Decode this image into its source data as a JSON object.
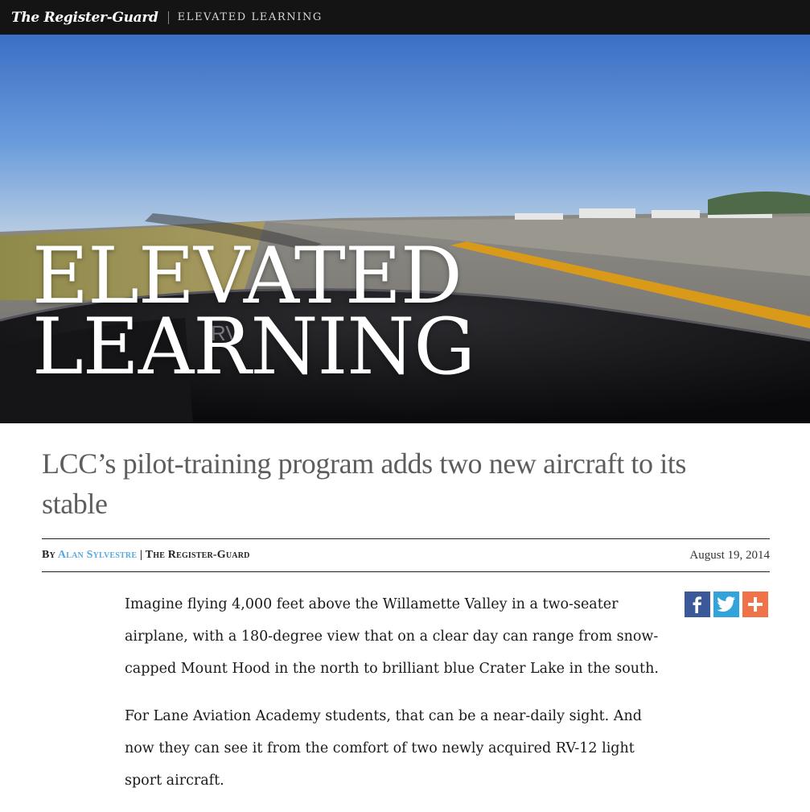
{
  "header": {
    "logo_text": "The Register-Guard",
    "section_label": "ELEVATED LEARNING"
  },
  "hero": {
    "title_line1": "ELEVATED",
    "title_line2": "LEARNING",
    "image_description": "cockpit-view-runway-photo"
  },
  "article": {
    "headline": "LCC’s pilot-training program adds two new aircraft to its stable",
    "byline_prefix": "By",
    "author": "Alan Sylvestre",
    "separator": "|",
    "publication": "The Register-Guard",
    "date": "August 19, 2014",
    "paragraphs": [
      "Imagine flying 4,000 feet above the Willamette Valley in a two-seater airplane, with a 180-degree view that on a clear day can range from snow-capped Mount Hood in the north to brilliant blue Crater Lake in the south.",
      "For Lane Aviation Academy students, that can be a near-daily sight. And now they can see it from the comfort of two newly acquired RV-12 light sport aircraft."
    ]
  },
  "share": {
    "buttons": [
      {
        "name": "facebook",
        "icon": "facebook-icon",
        "color": "#3b5998"
      },
      {
        "name": "twitter",
        "icon": "twitter-icon",
        "color": "#33a3dc"
      },
      {
        "name": "more",
        "icon": "plus-icon",
        "color": "#f07249"
      }
    ]
  },
  "colors": {
    "topbar_bg": "#141414",
    "author_link": "#57a9e0",
    "headline_text": "#5d5d5d"
  }
}
